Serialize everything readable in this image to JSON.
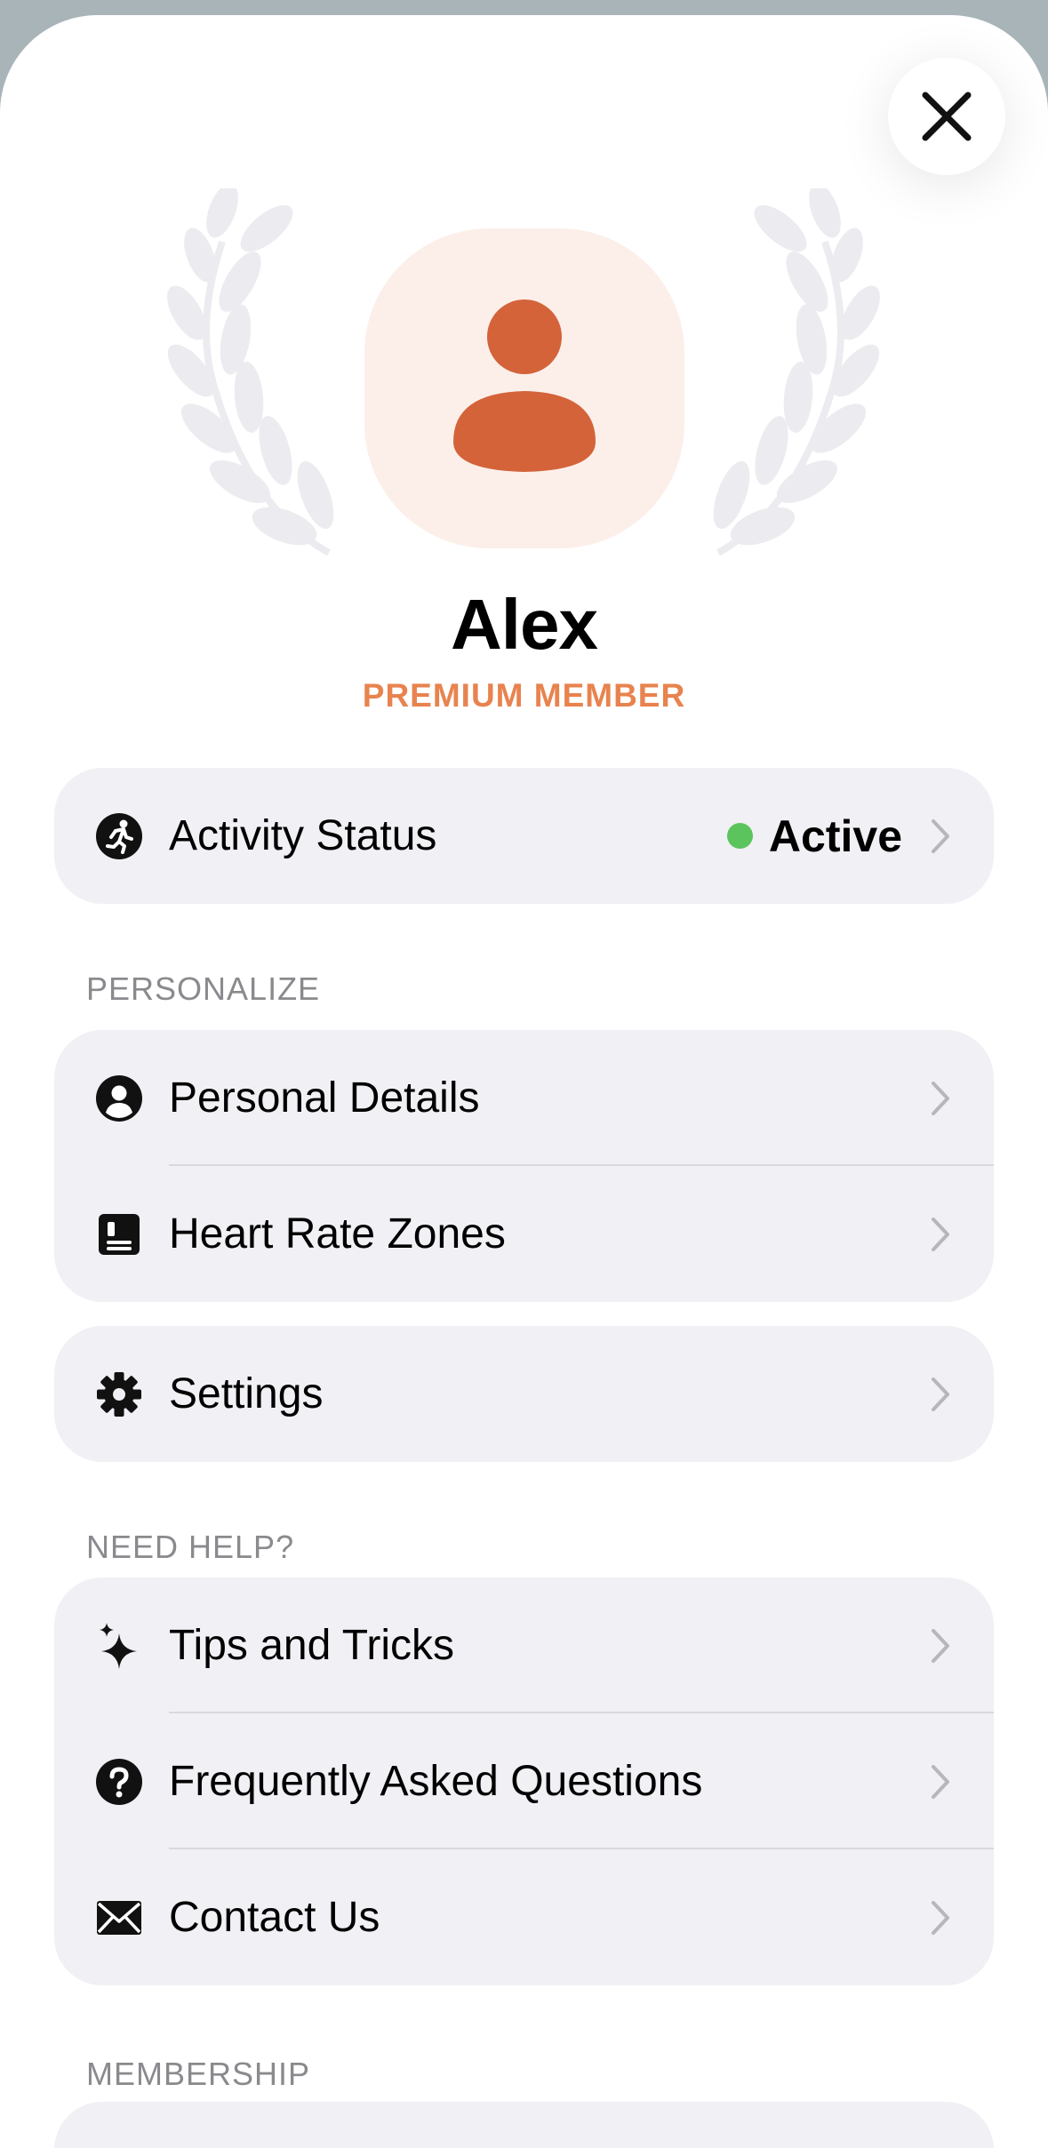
{
  "profile": {
    "name": "Alex",
    "membership": "PREMIUM MEMBER",
    "avatar_icon": "person-icon",
    "accent_color": "#d4633a"
  },
  "activity": {
    "label": "Activity Status",
    "status": "Active",
    "status_color": "#5cc45c"
  },
  "sections": {
    "personalize": {
      "header": "PERSONALIZE",
      "items": [
        {
          "label": "Personal Details",
          "icon": "person-circle-icon"
        },
        {
          "label": "Heart Rate Zones",
          "icon": "list-card-icon"
        }
      ]
    },
    "settings": {
      "items": [
        {
          "label": "Settings",
          "icon": "gear-icon"
        }
      ]
    },
    "help": {
      "header": "NEED HELP?",
      "items": [
        {
          "label": "Tips and Tricks",
          "icon": "sparkles-icon"
        },
        {
          "label": "Frequently Asked Questions",
          "icon": "question-circle-icon"
        },
        {
          "label": "Contact Us",
          "icon": "envelope-icon"
        }
      ]
    },
    "membership": {
      "header": "MEMBERSHIP"
    }
  }
}
